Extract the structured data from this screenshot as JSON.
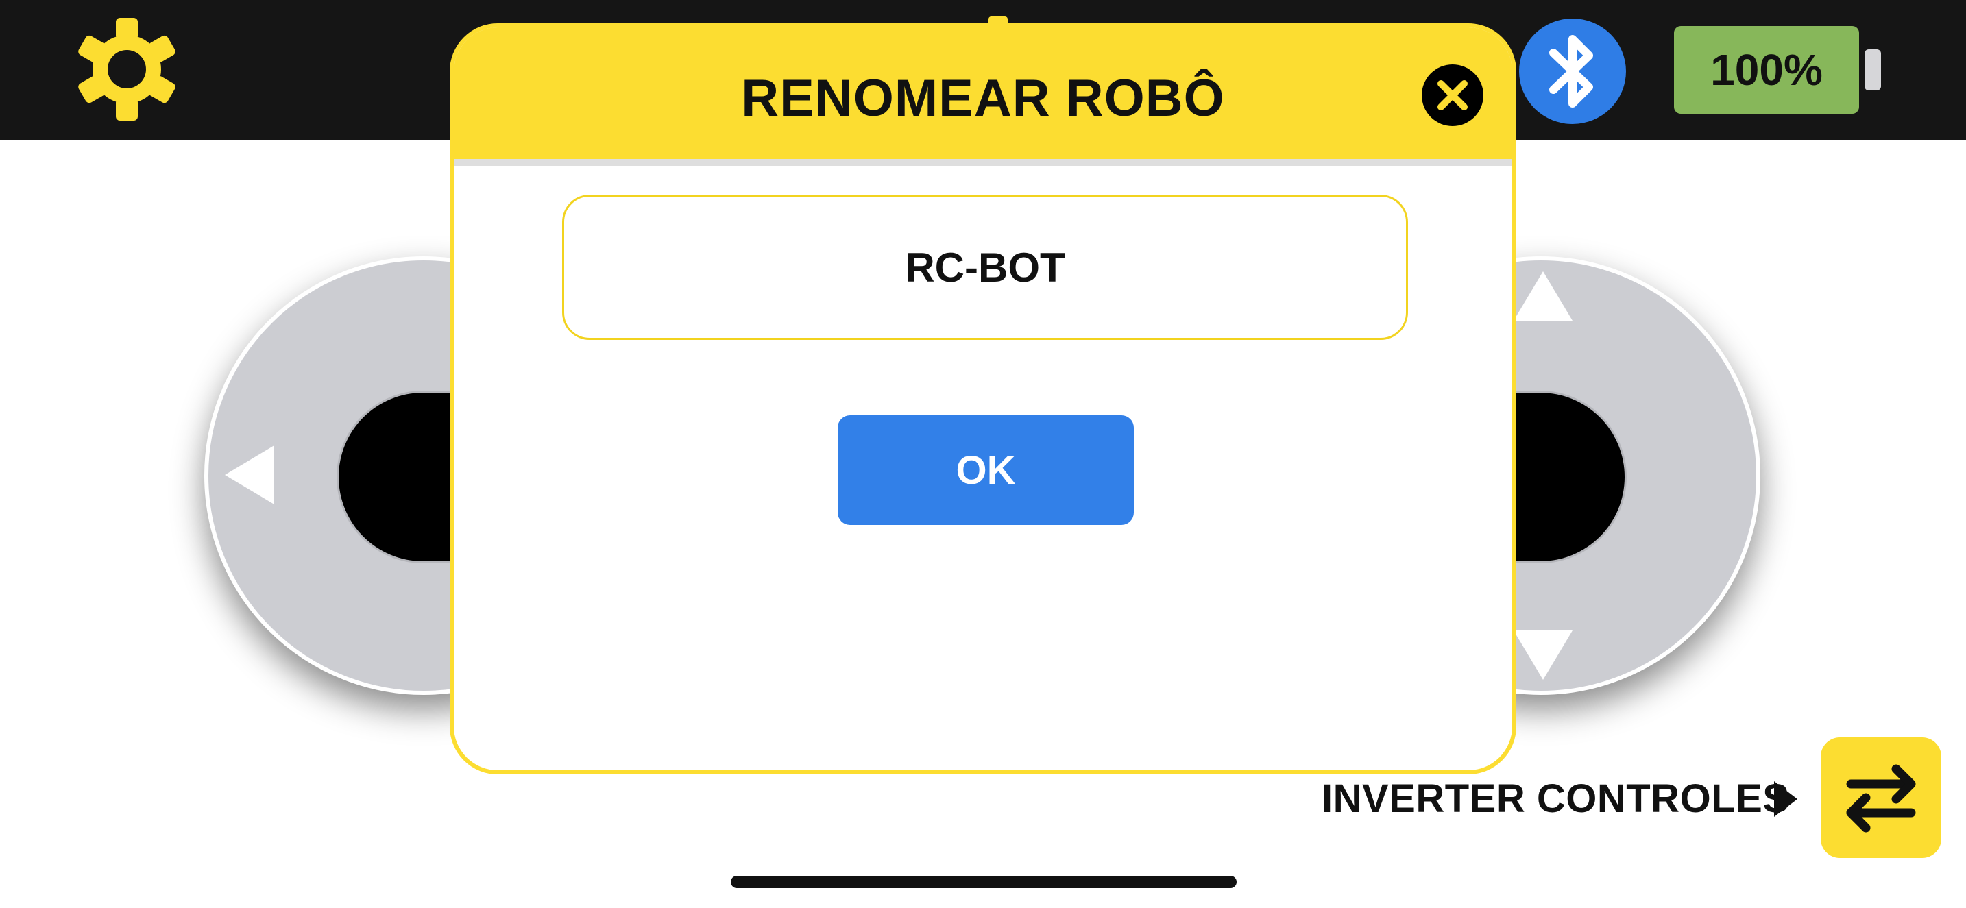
{
  "topbar": {
    "settings_icon": "gear-icon",
    "bluetooth_icon": "bluetooth-icon",
    "battery_level": "100%"
  },
  "controls": {
    "left_arrow_icon": "triangle-left-icon",
    "up_arrow_icon": "triangle-up-icon",
    "down_arrow_icon": "triangle-down-icon",
    "swap_label": "INVERTER CONTROLES",
    "swap_icon": "swap-arrows-icon"
  },
  "modal": {
    "title": "RENOMEAR ROBÔ",
    "close_icon": "close-icon",
    "name_value": "RC-BOT",
    "ok_label": "OK"
  },
  "colors": {
    "accent_yellow": "#fcdd31",
    "primary_blue": "#3280e8",
    "topbar_bg": "#151515",
    "battery_green": "#87b75a",
    "pad_gray": "#cccdd2"
  }
}
